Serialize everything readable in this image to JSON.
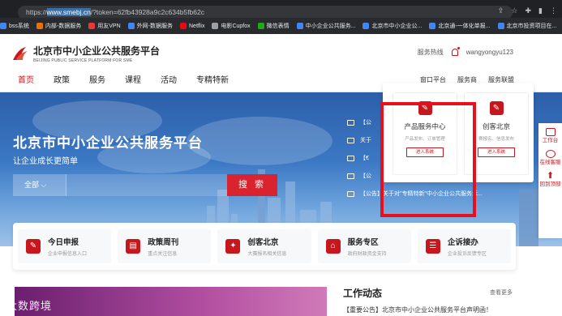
{
  "browser": {
    "url_prefix": "https://",
    "url_domain": "www.smebj.cn",
    "url_rest": "/?token=62fb43928a9c2c634b5fb62c",
    "bookmarks": [
      "bss系统",
      "内部-数据服务",
      "用友VPN",
      "外网-数据服务",
      "Netflix",
      "电影Cupfox",
      "微信表情",
      "中小企业公共服务...",
      "北京市中小企业公...",
      "北京通-一体化单报...",
      "北京市投资项目在..."
    ]
  },
  "header": {
    "logo_title": "北京市中小企业公共服务平台",
    "logo_subtitle": "BEIJING PUBLIC SERVICE PLATFORM FOR SME",
    "hotline": "服务热线",
    "username": "wangyongyu123"
  },
  "nav": {
    "items": [
      "首页",
      "政策",
      "服务",
      "课程",
      "活动",
      "专精特新"
    ],
    "right_items": [
      "窗口平台",
      "服务商",
      "服务联盟"
    ]
  },
  "hero": {
    "title": "北京市中小企业公共服务平台",
    "subtitle": "让企业成长更简单",
    "search_select": "全部",
    "search_button": "搜 索",
    "notices": [
      "【公",
      "关于",
      "【€",
      "【公",
      "【公告】关于对\"专精特新\"中小企业公共服务示..."
    ]
  },
  "dropdown": {
    "cards": [
      {
        "title": "产品服务中心",
        "desc": "产品发布、订单管理",
        "button": "进入系统"
      },
      {
        "title": "创客北京",
        "desc": "赛报名、信息发布",
        "button": "进入系统"
      }
    ]
  },
  "side_float": [
    "工作台",
    "在线客服",
    "回到顶部"
  ],
  "services": [
    {
      "name": "今日申报",
      "desc": "企业申报信息入口"
    },
    {
      "name": "政策周刊",
      "desc": "重点关注信息"
    },
    {
      "name": "创客北京",
      "desc": "大赛报名相关信息"
    },
    {
      "name": "服务专区",
      "desc": "政府财政资金支持"
    },
    {
      "name": "企诉接办",
      "desc": "企业投诉反馈专区"
    }
  ],
  "work": {
    "title": "工作动态",
    "more": "查看更多",
    "item": "【重要公告】北京市中小企业公共服务平台声明函！"
  },
  "watermark": "大数跨境",
  "colors": {
    "brand_red": "#c8161d",
    "highlight_box": "#e8101a"
  }
}
